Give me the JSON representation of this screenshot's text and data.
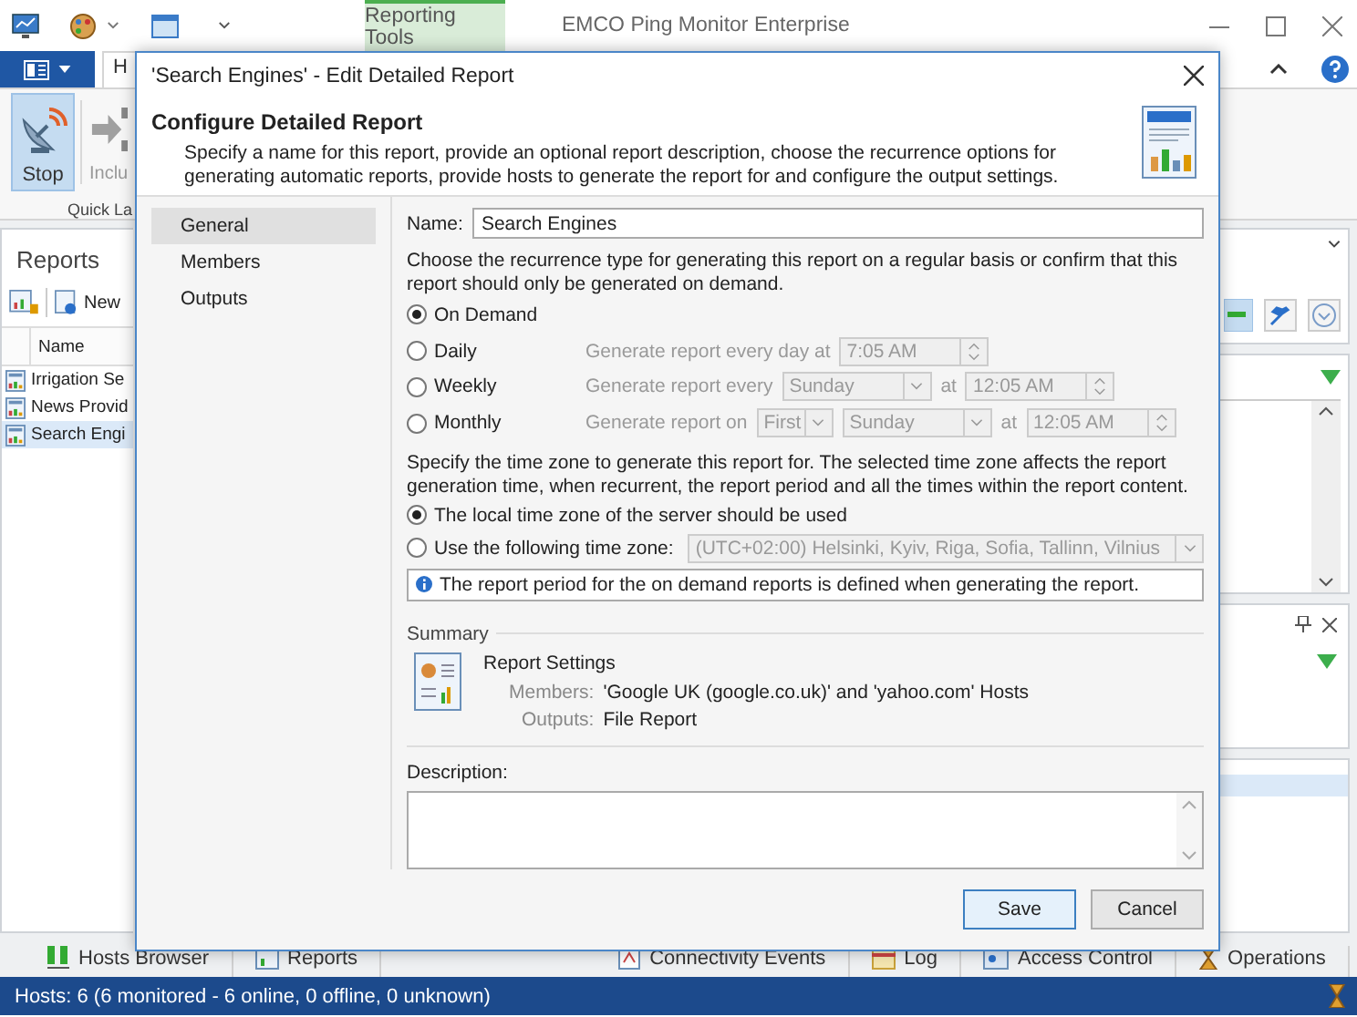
{
  "app": {
    "context_tab": "Reporting Tools",
    "title": "EMCO Ping Monitor Enterprise",
    "ribbon_tab": "H",
    "ribbon_buttons": [
      {
        "label": "Stop",
        "selected": true,
        "kind": "stop"
      },
      {
        "label": "Inclu",
        "selected": false,
        "kind": "include"
      }
    ],
    "ribbon_group": "Quick La"
  },
  "reports_panel": {
    "title": "Reports",
    "toolbar_button": "New",
    "column": "Name",
    "rows": [
      {
        "name": "Irrigation Se",
        "selected": false
      },
      {
        "name": "News Provid",
        "selected": false
      },
      {
        "name": "Search Engi",
        "selected": true
      }
    ]
  },
  "dialog": {
    "title": "'Search Engines' - Edit Detailed Report",
    "heading": "Configure Detailed Report",
    "description": "Specify a name for this report, provide an optional report description, choose the recurrence options for generating automatic reports, provide hosts to generate the report for and configure the output settings.",
    "nav": [
      {
        "label": "General",
        "selected": true
      },
      {
        "label": "Members",
        "selected": false
      },
      {
        "label": "Outputs",
        "selected": false
      }
    ],
    "name_label": "Name:",
    "name_value": "Search Engines",
    "recurrence_text": "Choose the recurrence type for generating this report on a regular basis or confirm that this report should only be generated on demand.",
    "recurrence": [
      {
        "kind": "plain",
        "label": "On Demand",
        "selected": true
      },
      {
        "kind": "daily",
        "label": "Daily",
        "selected": false,
        "prompt": "Generate report every day at",
        "time": "7:05 AM"
      },
      {
        "kind": "weekly",
        "label": "Weekly",
        "selected": false,
        "prompt": "Generate report every",
        "day": "Sunday",
        "at": "at",
        "time": "12:05 AM"
      },
      {
        "kind": "monthly",
        "label": "Monthly",
        "selected": false,
        "prompt": "Generate report on",
        "week": "First",
        "day": "Sunday",
        "at": "at",
        "time": "12:05 AM"
      }
    ],
    "timezone_text": "Specify the time zone to generate this report for. The selected time zone affects the report generation time, when recurrent, the report period and all the times within the report content.",
    "timezone_options": [
      {
        "label": "The local time zone of the server should be used",
        "selected": true
      },
      {
        "label": "Use the following time zone:",
        "selected": false,
        "value": "(UTC+02:00) Helsinki, Kyiv, Riga, Sofia, Tallinn, Vilnius"
      }
    ],
    "info": "The report period for the on demand reports is defined when generating the report.",
    "summary": {
      "title": "Summary",
      "heading": "Report Settings",
      "rows": [
        {
          "label": "Members:",
          "value": "'Google UK (google.co.uk)' and 'yahoo.com' Hosts"
        },
        {
          "label": "Outputs:",
          "value": "File Report"
        }
      ]
    },
    "description_label": "Description:",
    "buttons": [
      {
        "label": "Save",
        "default": true
      },
      {
        "label": "Cancel",
        "default": false
      }
    ]
  },
  "bottom_tabs": [
    "Hosts Browser",
    "Reports",
    "Connectivity Events",
    "Log",
    "Access Control",
    "Operations"
  ],
  "status_bar": "Hosts: 6 (6 monitored - 6 online, 0 offline, 0 unknown)"
}
